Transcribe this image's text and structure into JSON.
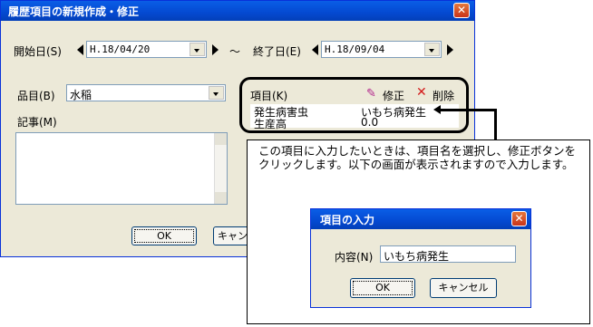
{
  "main": {
    "title": "履歴項目の新規作成・修正",
    "start_label": "開始日(S)",
    "start_value": "H.18/04/20",
    "tilde": "～",
    "end_label": "終了日(E)",
    "end_value": "H.18/09/04",
    "item_label": "品目(B)",
    "item_value": "水稲",
    "notes_label": "記事(M)",
    "items_label": "項目(K)",
    "edit_label": "修正",
    "delete_label": "削除",
    "rows": [
      {
        "name": "発生病害虫",
        "value": "いもち病発生"
      },
      {
        "name": "生産高",
        "value": "0.0"
      }
    ],
    "ok_label": "OK",
    "cancel_label": "キャン"
  },
  "callout": {
    "text": "この項目に入力したいときは、項目名を選択し、修正ボタンをクリックします。以下の画面が表示されますので入力します。"
  },
  "sub": {
    "title": "項目の入力",
    "content_label": "内容(N)",
    "content_value": "いもち病発生",
    "ok_label": "OK",
    "cancel_label": "キャンセル"
  },
  "colors": {
    "title_blue": "#0449d1",
    "close_red": "#c9341a",
    "dialog_bg": "#ece9d8"
  }
}
